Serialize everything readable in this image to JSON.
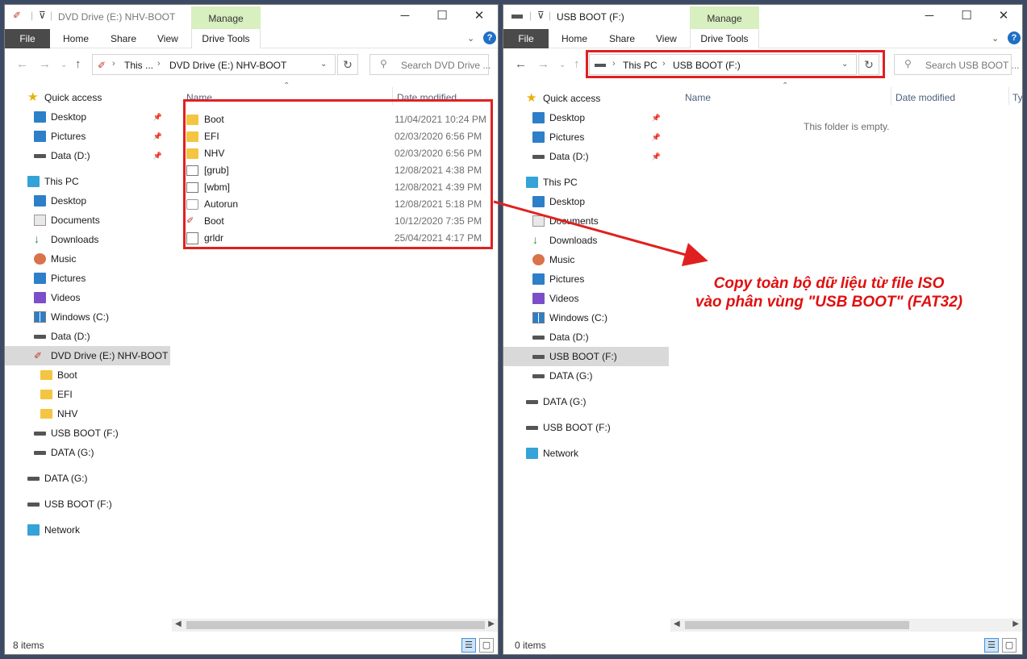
{
  "left": {
    "title": "DVD Drive (E:) NHV-BOOT",
    "manage_label": "Manage",
    "drive_tools_label": "Drive Tools",
    "ribbon_tabs": [
      "File",
      "Home",
      "Share",
      "View"
    ],
    "address": {
      "crumb1": "This ...",
      "crumb2": "DVD Drive (E:) NHV-BOOT"
    },
    "search_placeholder": "Search DVD Drive ...",
    "columns": {
      "name": "Name",
      "date": "Date modified"
    },
    "files": [
      {
        "name": "Boot",
        "date": "11/04/2021 10:24 PM",
        "icon": "folder"
      },
      {
        "name": "EFI",
        "date": "02/03/2020 6:56 PM",
        "icon": "folder"
      },
      {
        "name": "NHV",
        "date": "02/03/2020 6:56 PM",
        "icon": "folder"
      },
      {
        "name": "[grub]",
        "date": "12/08/2021 4:38 PM",
        "icon": "system-file"
      },
      {
        "name": "[wbm]",
        "date": "12/08/2021 4:39 PM",
        "icon": "system-file"
      },
      {
        "name": "Autorun",
        "date": "12/08/2021 5:18 PM",
        "icon": "settings-file"
      },
      {
        "name": "Boot",
        "date": "10/12/2020 7:35 PM",
        "icon": "boot-image"
      },
      {
        "name": "grldr",
        "date": "25/04/2021 4:17 PM",
        "icon": "blank-file"
      }
    ],
    "nav": [
      {
        "label": "Quick access",
        "icon": "star-icon"
      },
      {
        "label": "Desktop",
        "icon": "desktop-icon"
      },
      {
        "label": "Pictures",
        "icon": "pictures-icon"
      },
      {
        "label": "Data (D:)",
        "icon": "drive-icon"
      },
      {
        "label": "This PC",
        "icon": "pc-icon"
      },
      {
        "label": "Desktop",
        "icon": "desktop-icon"
      },
      {
        "label": "Documents",
        "icon": "documents-icon"
      },
      {
        "label": "Downloads",
        "icon": "downloads-icon"
      },
      {
        "label": "Music",
        "icon": "music-icon"
      },
      {
        "label": "Pictures",
        "icon": "pictures-icon"
      },
      {
        "label": "Videos",
        "icon": "videos-icon"
      },
      {
        "label": "Windows (C:)",
        "icon": "windows-drive-icon"
      },
      {
        "label": "Data (D:)",
        "icon": "drive-icon"
      },
      {
        "label": "DVD Drive (E:) NHV-BOOT",
        "icon": "dvd-icon",
        "selected": true
      },
      {
        "label": "Boot",
        "icon": "folder-icon"
      },
      {
        "label": "EFI",
        "icon": "folder-icon"
      },
      {
        "label": "NHV",
        "icon": "folder-icon"
      },
      {
        "label": "USB BOOT (F:)",
        "icon": "drive-icon"
      },
      {
        "label": "DATA (G:)",
        "icon": "drive-icon"
      },
      {
        "label": "DATA (G:)",
        "icon": "drive-icon"
      },
      {
        "label": "USB BOOT (F:)",
        "icon": "drive-icon"
      },
      {
        "label": "Network",
        "icon": "network-icon"
      }
    ],
    "status": "8 items"
  },
  "right": {
    "title": "USB BOOT (F:)",
    "manage_label": "Manage",
    "drive_tools_label": "Drive Tools",
    "ribbon_tabs": [
      "File",
      "Home",
      "Share",
      "View"
    ],
    "address": {
      "crumb1": "This PC",
      "crumb2": "USB BOOT (F:)"
    },
    "search_placeholder": "Search USB BOOT ...",
    "columns": {
      "name": "Name",
      "date": "Date modified",
      "type": "Ty"
    },
    "empty_message": "This folder is empty.",
    "nav": [
      {
        "label": "Quick access",
        "icon": "star-icon"
      },
      {
        "label": "Desktop",
        "icon": "desktop-icon"
      },
      {
        "label": "Pictures",
        "icon": "pictures-icon"
      },
      {
        "label": "Data (D:)",
        "icon": "drive-icon"
      },
      {
        "label": "This PC",
        "icon": "pc-icon"
      },
      {
        "label": "Desktop",
        "icon": "desktop-icon"
      },
      {
        "label": "Documents",
        "icon": "documents-icon"
      },
      {
        "label": "Downloads",
        "icon": "downloads-icon"
      },
      {
        "label": "Music",
        "icon": "music-icon"
      },
      {
        "label": "Pictures",
        "icon": "pictures-icon"
      },
      {
        "label": "Videos",
        "icon": "videos-icon"
      },
      {
        "label": "Windows (C:)",
        "icon": "windows-drive-icon"
      },
      {
        "label": "Data (D:)",
        "icon": "drive-icon"
      },
      {
        "label": "USB BOOT (F:)",
        "icon": "drive-icon",
        "selected": true
      },
      {
        "label": "DATA (G:)",
        "icon": "drive-icon"
      },
      {
        "label": "DATA (G:)",
        "icon": "drive-icon"
      },
      {
        "label": "USB BOOT (F:)",
        "icon": "drive-icon"
      },
      {
        "label": "Network",
        "icon": "network-icon"
      }
    ],
    "status": "0 items"
  },
  "annotation": {
    "line1": "Copy toàn bộ dữ liệu từ file ISO",
    "line2": "vào phân vùng \"USB BOOT\" (FAT32)"
  },
  "colors": {
    "highlight": "#e02020",
    "annotation": "#e01010",
    "manage_tab": "#d8efc0"
  }
}
